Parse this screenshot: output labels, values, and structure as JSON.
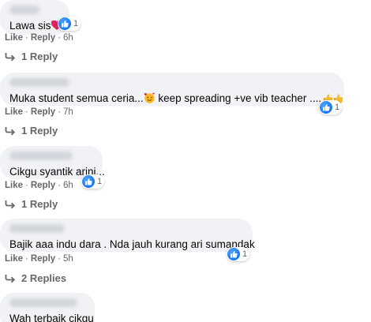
{
  "comments": [
    {
      "text": "Lawa sis",
      "reaction_count": "1",
      "like_label": "Like",
      "reply_label": "Reply",
      "time": "6h",
      "replies_label": "1 Reply"
    },
    {
      "text": "Muka student semua ceria...",
      "text_tail": " keep spreading +ve vib teacher ....",
      "reaction_count": "1",
      "like_label": "Like",
      "reply_label": "Reply",
      "time": "7h",
      "replies_label": "1 Reply"
    },
    {
      "text": "Cikgu syantik arini...",
      "reaction_count": "1",
      "like_label": "Like",
      "reply_label": "Reply",
      "time": "6h",
      "replies_label": "1 Reply"
    },
    {
      "text": "Bajik aaa indu dara . Nda jauh kurang ari sumandak",
      "reaction_count": "1",
      "like_label": "Like",
      "reply_label": "Reply",
      "time": "5h",
      "replies_label": "2 Replies"
    },
    {
      "text": "Wah terbaik cikgu"
    }
  ],
  "separator": "·",
  "icons": {
    "reaction": "like-icon",
    "reply": "reply-arrow-icon",
    "heart": "red-heart-emoji",
    "party": "smiling-face-hearts-emoji",
    "thumbs": "thumbs-up-emoji"
  },
  "colors": {
    "bubble": "#f0f2f5",
    "like_blue": "#1877f2",
    "meta_gray": "#65676b"
  }
}
